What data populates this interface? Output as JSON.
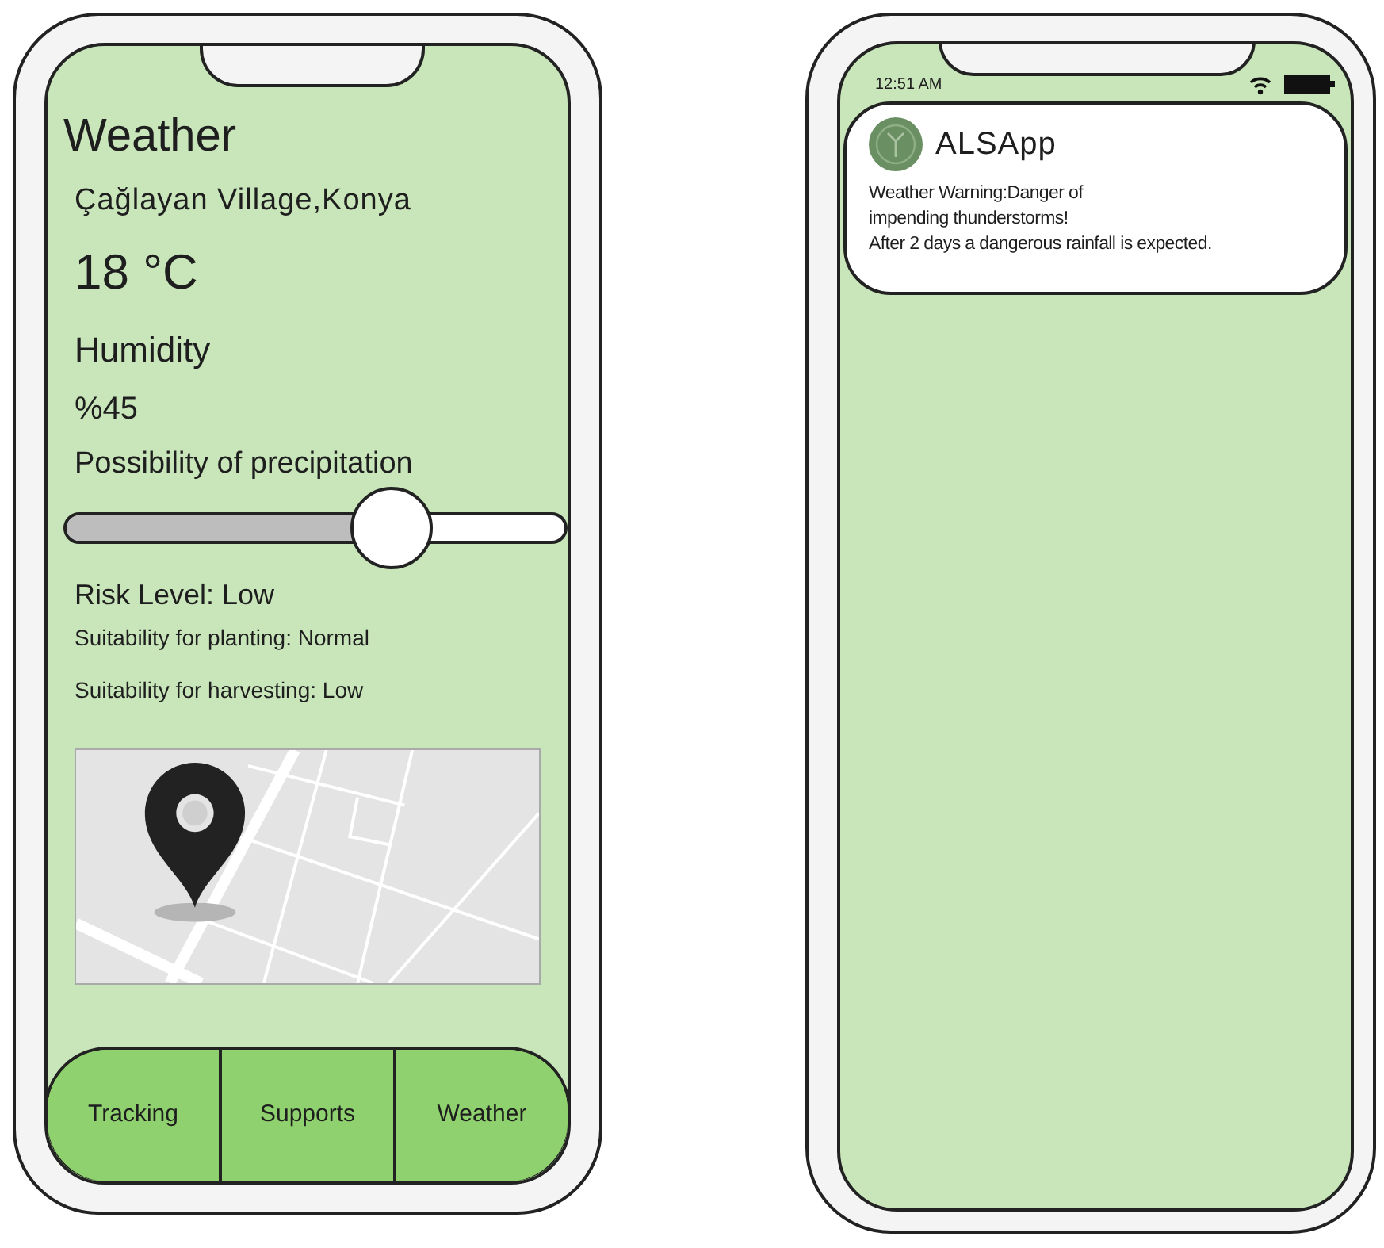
{
  "weather_screen": {
    "title": "Weather",
    "location": "Çağlayan Village,Konya",
    "temperature": "18 °C",
    "humidity_label": "Humidity",
    "humidity_value": "%45",
    "precipitation_label": "Possibility of precipitation",
    "precipitation_slider": {
      "level": 0.65
    },
    "risk_level": "Risk Level: Low",
    "planting_suitability": "Suitability for planting: Normal",
    "harvesting_suitability": "Suitability for harvesting: Low",
    "tabs": [
      {
        "label": "Tracking"
      },
      {
        "label": "Supports"
      },
      {
        "label": "Weather"
      }
    ]
  },
  "notification_screen": {
    "status_bar": {
      "time": "12:51 AM"
    },
    "notification": {
      "app_name": "ALSApp",
      "lines": [
        "Weather Warning:Danger of",
        "impending thunderstorms!",
        "After 2 days a dangerous rainfall is expected."
      ]
    }
  }
}
